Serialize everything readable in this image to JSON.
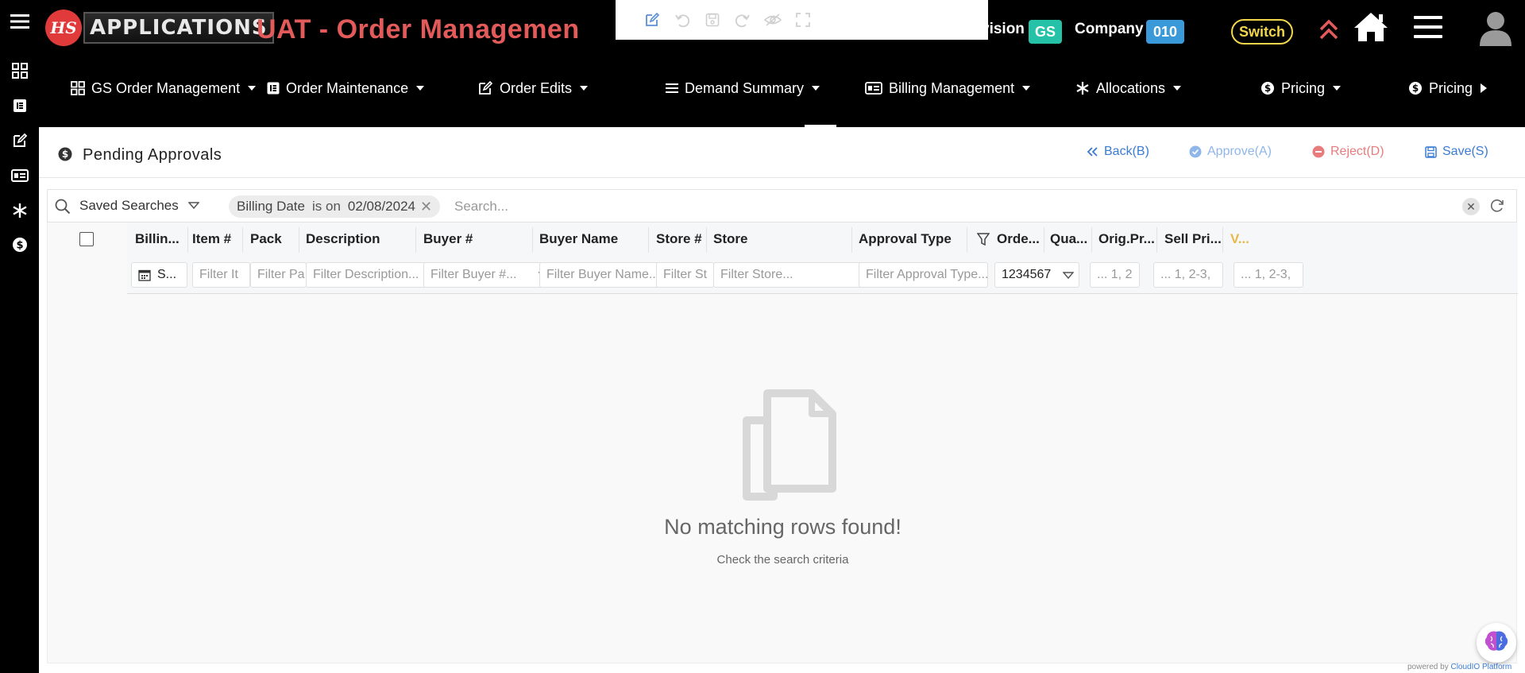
{
  "header": {
    "logo_mark": "HS",
    "logo_text": "APPLICATIONS",
    "app_title": "UAT - Order Managemen",
    "division_label": "Division",
    "division_value": "GS",
    "company_label": "Company",
    "company_value": "010",
    "switch_label": "Switch"
  },
  "nav": {
    "items": [
      {
        "label": "GS Order Management",
        "icon": "grid-icon"
      },
      {
        "label": "Order Maintenance",
        "icon": "document-icon"
      },
      {
        "label": "Order Edits",
        "icon": "edit-icon"
      },
      {
        "label": "Demand Summary",
        "icon": "list-icon"
      },
      {
        "label": "Billing Management",
        "icon": "id-card-icon"
      },
      {
        "label": "Allocations",
        "icon": "asterisk-icon"
      },
      {
        "label": "Pricing",
        "icon": "dollar-coin-icon"
      },
      {
        "label": "Pricing",
        "icon": "dollar-coin-icon"
      }
    ]
  },
  "page": {
    "title": "Pending Approvals",
    "actions": {
      "back": "Back(B)",
      "approve": "Approve(A)",
      "reject": "Reject(D)",
      "save": "Save(S)"
    }
  },
  "search": {
    "saved_searches": "Saved Searches",
    "chip_field": "Billing Date",
    "chip_operator": "is on",
    "chip_value": "02/08/2024",
    "placeholder": "Search..."
  },
  "grid": {
    "columns": [
      "Billin...",
      "Item #",
      "Pack",
      "Description",
      "Buyer #",
      "Buyer Name",
      "Store #",
      "Store",
      "Approval Type",
      "Orde...",
      "Qua...",
      "Orig.Pr...",
      "Sell Pri...",
      "V..."
    ],
    "filters": {
      "billing": "S...",
      "item": "Filter It",
      "pack": "Filter Pa",
      "description": "Filter Description...",
      "buyer": "Filter Buyer #...",
      "buyer_name": "Filter Buyer Name...",
      "store_no": "Filter St",
      "store": "Filter Store...",
      "approval_type": "Filter Approval Type...",
      "order": "1234567",
      "qty": "... 1, 2",
      "orig_price": "... 1, 2-3,",
      "sell_price": "... 1, 2-3,"
    },
    "empty_title": "No matching rows found!",
    "empty_subtitle": "Check the search criteria"
  },
  "footer": {
    "powered_prefix": "powered by",
    "powered_brand": "CloudIO Platform"
  },
  "colors": {
    "brand_red": "#e35a5a",
    "division_badge": "#26c2a8",
    "company_badge": "#3a9ad9",
    "switch_yellow": "#f3d64a",
    "action_blue": "#3a7bd5",
    "reject_red": "#e87c7c"
  }
}
